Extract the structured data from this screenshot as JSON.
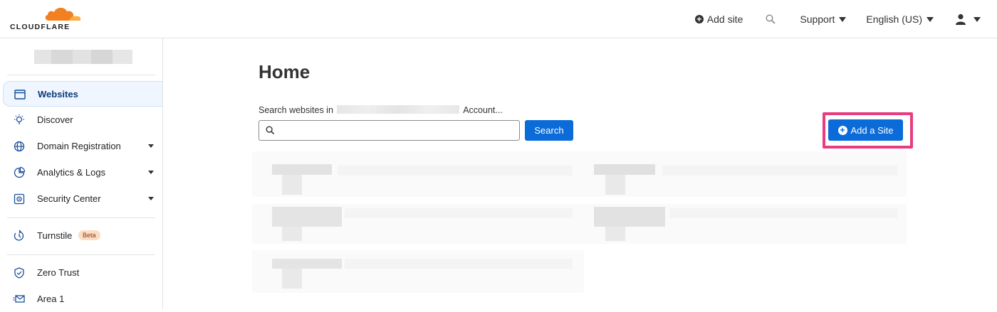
{
  "header": {
    "logo_text": "CLOUDFLARE",
    "add_site_label": "Add site",
    "search_icon": "search-icon",
    "support_label": "Support",
    "language_label": "English (US)",
    "user_icon": "user-icon",
    "brand_color": "#f38020"
  },
  "sidebar": {
    "items": [
      {
        "label": "Websites",
        "icon": "browser-window-icon",
        "active": true
      },
      {
        "label": "Discover",
        "icon": "lightbulb-icon"
      },
      {
        "label": "Domain Registration",
        "icon": "globe-icon",
        "expandable": true
      },
      {
        "label": "Analytics & Logs",
        "icon": "pie-chart-icon",
        "expandable": true
      },
      {
        "label": "Security Center",
        "icon": "security-center-icon",
        "expandable": true
      },
      {
        "label": "Turnstile",
        "icon": "turnstile-icon",
        "badge": "Beta"
      },
      {
        "label": "Zero Trust",
        "icon": "shield-icon"
      },
      {
        "label": "Area 1",
        "icon": "mail-icon"
      }
    ]
  },
  "main": {
    "title": "Home",
    "search_label_prefix": "Search websites in",
    "search_label_suffix": "Account...",
    "search_value": "",
    "search_button": "Search",
    "add_site_button": "Add a Site",
    "accent_color": "#0a6bd9",
    "highlight_color": "#ea3b7e"
  }
}
